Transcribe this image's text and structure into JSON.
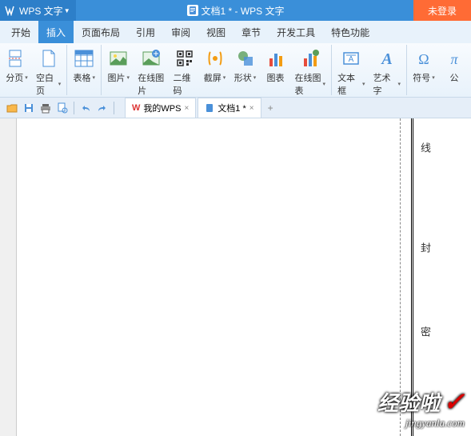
{
  "app": {
    "name": "WPS 文字",
    "title": "文档1 * - WPS 文字",
    "login": "未登录"
  },
  "menu": {
    "items": [
      "开始",
      "插入",
      "页面布局",
      "引用",
      "审阅",
      "视图",
      "章节",
      "开发工具",
      "特色功能"
    ],
    "active": 1
  },
  "ribbon": {
    "pagebreak": "分页",
    "blankpage": "空白页",
    "table": "表格",
    "picture": "图片",
    "onlinepic": "在线图片",
    "qrcode": "二维码",
    "screenshot": "截屏",
    "shape": "形状",
    "chart": "图表",
    "onlinechart": "在线图表",
    "textbox": "文本框",
    "wordart": "艺术字",
    "symbol": "符号",
    "formula": "公"
  },
  "tabs": {
    "wps": "我的WPS",
    "doc1": "文档1 *"
  },
  "page": {
    "v1": "线",
    "v2": "封",
    "v3": "密"
  },
  "watermark": {
    "main": "经验啦",
    "sub": "jingyanla.com"
  }
}
